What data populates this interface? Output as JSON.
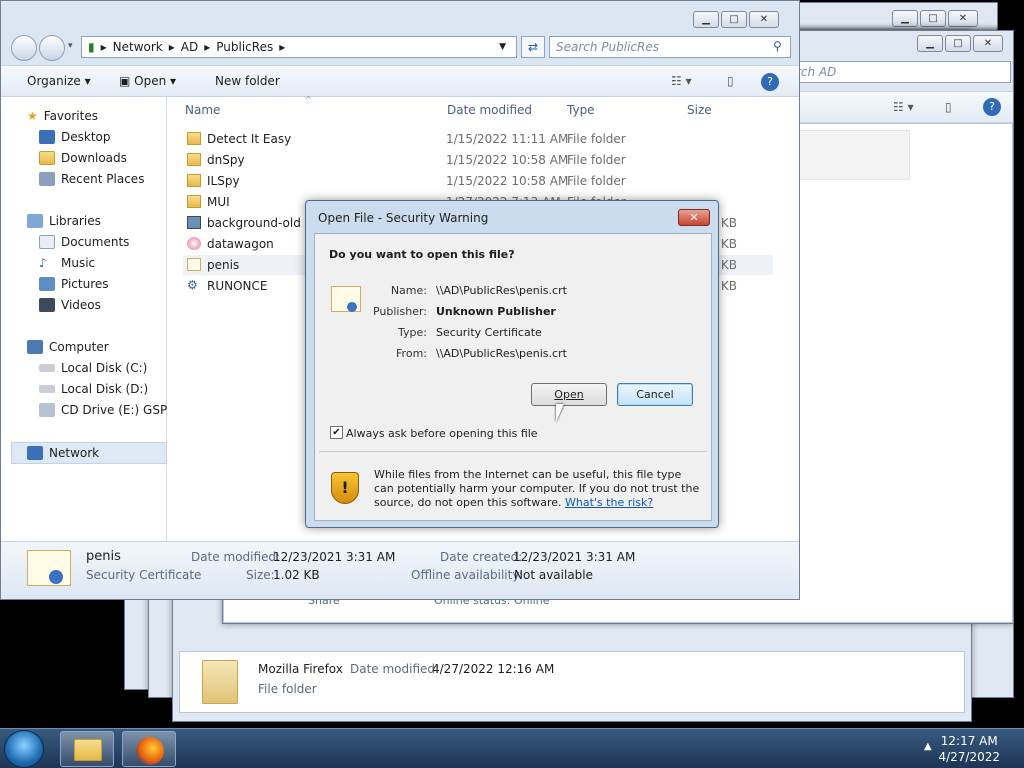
{
  "explorer": {
    "breadcrumb": [
      "Network",
      "AD",
      "PublicRes"
    ],
    "search_placeholder": "Search PublicRes",
    "toolbar": {
      "organize": "Organize",
      "open": "Open",
      "new_folder": "New folder"
    },
    "nav": {
      "favorites": "Favorites",
      "fav_items": [
        "Desktop",
        "Downloads",
        "Recent Places"
      ],
      "libraries": "Libraries",
      "lib_items": [
        "Documents",
        "Music",
        "Pictures",
        "Videos"
      ],
      "computer": "Computer",
      "comp_items": [
        "Local Disk (C:)",
        "Local Disk (D:)",
        "CD Drive (E:) GSP1RM"
      ],
      "network": "Network"
    },
    "columns": {
      "name": "Name",
      "date": "Date modified",
      "type": "Type",
      "size": "Size"
    },
    "files": [
      {
        "name": "Detect It Easy",
        "date": "1/15/2022 11:11 AM",
        "type": "File folder",
        "size": ""
      },
      {
        "name": "dnSpy",
        "date": "1/15/2022 10:58 AM",
        "type": "File folder",
        "size": ""
      },
      {
        "name": "ILSpy",
        "date": "1/15/2022 10:58 AM",
        "type": "File folder",
        "size": ""
      },
      {
        "name": "MUI",
        "date": "1/27/2022 7:13 AM",
        "type": "File folder",
        "size": ""
      },
      {
        "name": "background-old",
        "date": "",
        "type": "",
        "size": "258 KB"
      },
      {
        "name": "datawagon",
        "date": "",
        "type": "",
        "size": "34 KB"
      },
      {
        "name": "penis",
        "date": "",
        "type": "",
        "size": "2 KB"
      },
      {
        "name": "RUNONCE",
        "date": "",
        "type": "",
        "size": "946 KB"
      }
    ],
    "details": {
      "name": "penis",
      "kind": "Security Certificate",
      "date_modified_label": "Date modified:",
      "date_modified": "12/23/2021 3:31 AM",
      "date_created_label": "Date created:",
      "date_created": "12/23/2021 3:31 AM",
      "size_label": "Size:",
      "size": "1.02 KB",
      "offline_label": "Offline availability:",
      "offline": "Not available"
    }
  },
  "bg_window": {
    "search_placeholder": "rch AD",
    "share": "Share",
    "online_status": "Online status: Online"
  },
  "bg_window2": {
    "name": "Mozilla Firefox",
    "date_label": "Date modified:",
    "date": "4/27/2022 12:16 AM",
    "kind": "File folder"
  },
  "dialog": {
    "title": "Open File - Security Warning",
    "question": "Do you want to open this file?",
    "name_label": "Name:",
    "name": "\\\\AD\\PublicRes\\penis.crt",
    "publisher_label": "Publisher:",
    "publisher": "Unknown Publisher",
    "type_label": "Type:",
    "type": "Security Certificate",
    "from_label": "From:",
    "from": "\\\\AD\\PublicRes\\penis.crt",
    "open_button": "Open",
    "cancel_button": "Cancel",
    "checkbox_label": "Always ask before opening this file",
    "warning_text": "While files from the Internet can be useful, this file type can potentially harm your computer. If you do not trust the source, do not open this software.",
    "risk_link": "What's the risk?"
  },
  "taskbar": {
    "time": "12:17 AM",
    "date": "4/27/2022"
  }
}
